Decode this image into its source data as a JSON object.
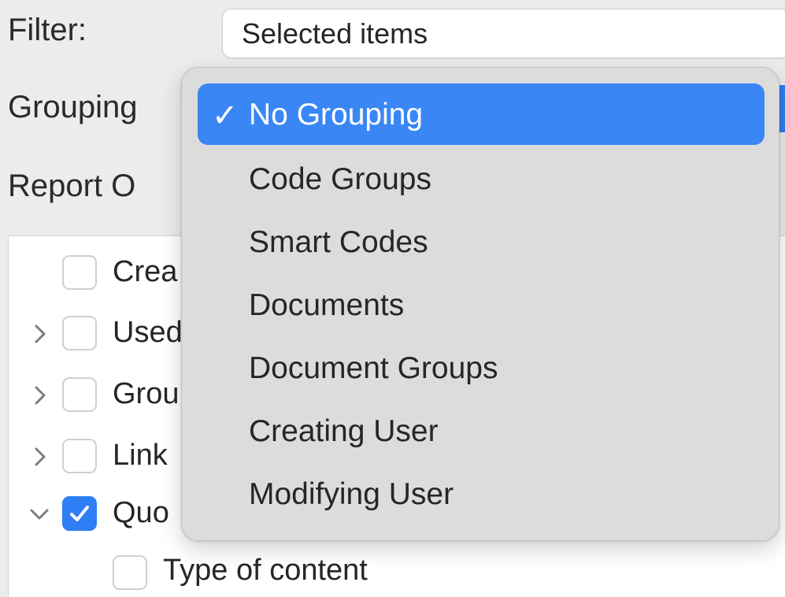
{
  "filter": {
    "label": "Filter:",
    "value": "Selected items"
  },
  "grouping": {
    "label": "Grouping"
  },
  "report_options": {
    "label": "Report O",
    "items": [
      {
        "label": "Crea",
        "checked": false,
        "disclosure": "none"
      },
      {
        "label": "Used",
        "checked": false,
        "disclosure": "collapsed"
      },
      {
        "label": "Grou",
        "checked": false,
        "disclosure": "collapsed"
      },
      {
        "label": "Link",
        "checked": false,
        "disclosure": "collapsed"
      },
      {
        "label": "Quo",
        "checked": true,
        "disclosure": "expanded"
      },
      {
        "label": "Type of content",
        "checked": false,
        "disclosure": "none"
      }
    ]
  },
  "menu": {
    "selected_index": 0,
    "check_mark": "✓",
    "items": [
      {
        "label": "No Grouping"
      },
      {
        "label": "Code Groups"
      },
      {
        "label": "Smart Codes"
      },
      {
        "label": "Documents"
      },
      {
        "label": "Document Groups"
      },
      {
        "label": "Creating User"
      },
      {
        "label": "Modifying User"
      }
    ]
  },
  "colors": {
    "accent": "#3a86f5",
    "menu_background": "#dcdcdc",
    "window_background": "#ececec"
  },
  "icons": {
    "stepper": "chevron-up-down-icon",
    "check": "checkmark-icon",
    "collapsed": "chevron-right-icon",
    "expanded": "chevron-down-icon"
  }
}
